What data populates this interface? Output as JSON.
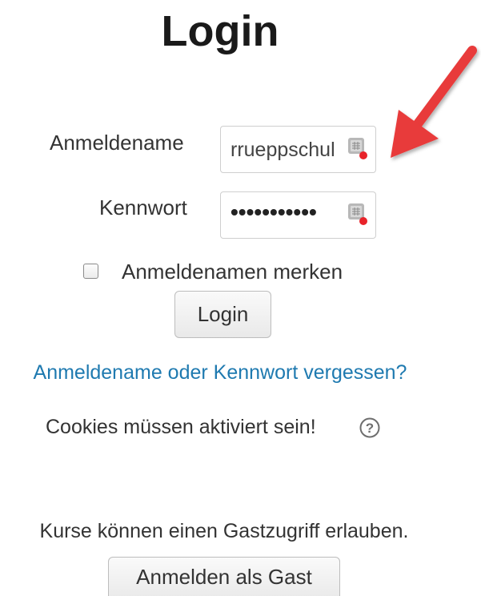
{
  "page": {
    "title": "Login"
  },
  "form": {
    "username_label": "Anmeldename",
    "username_value": "rrueppschul",
    "password_label": "Kennwort",
    "password_value": "•••••••••••",
    "remember_label": "Anmeldenamen merken",
    "remember_checked": false,
    "login_button": "Login",
    "forgot_link": "Anmeldename oder Kennwort vergessen?"
  },
  "cookies": {
    "text": "Cookies müssen aktiviert sein!"
  },
  "guest": {
    "text": "Kurse können einen Gastzugriff erlauben.",
    "button": "Anmelden als Gast"
  },
  "icons": {
    "password_manager": "keepass-icon",
    "help": "help-icon",
    "annotation": "red-arrow"
  },
  "colors": {
    "link": "#1f7ab0",
    "arrow": "#e83a3a",
    "indicator_dot": "#e8232a"
  }
}
